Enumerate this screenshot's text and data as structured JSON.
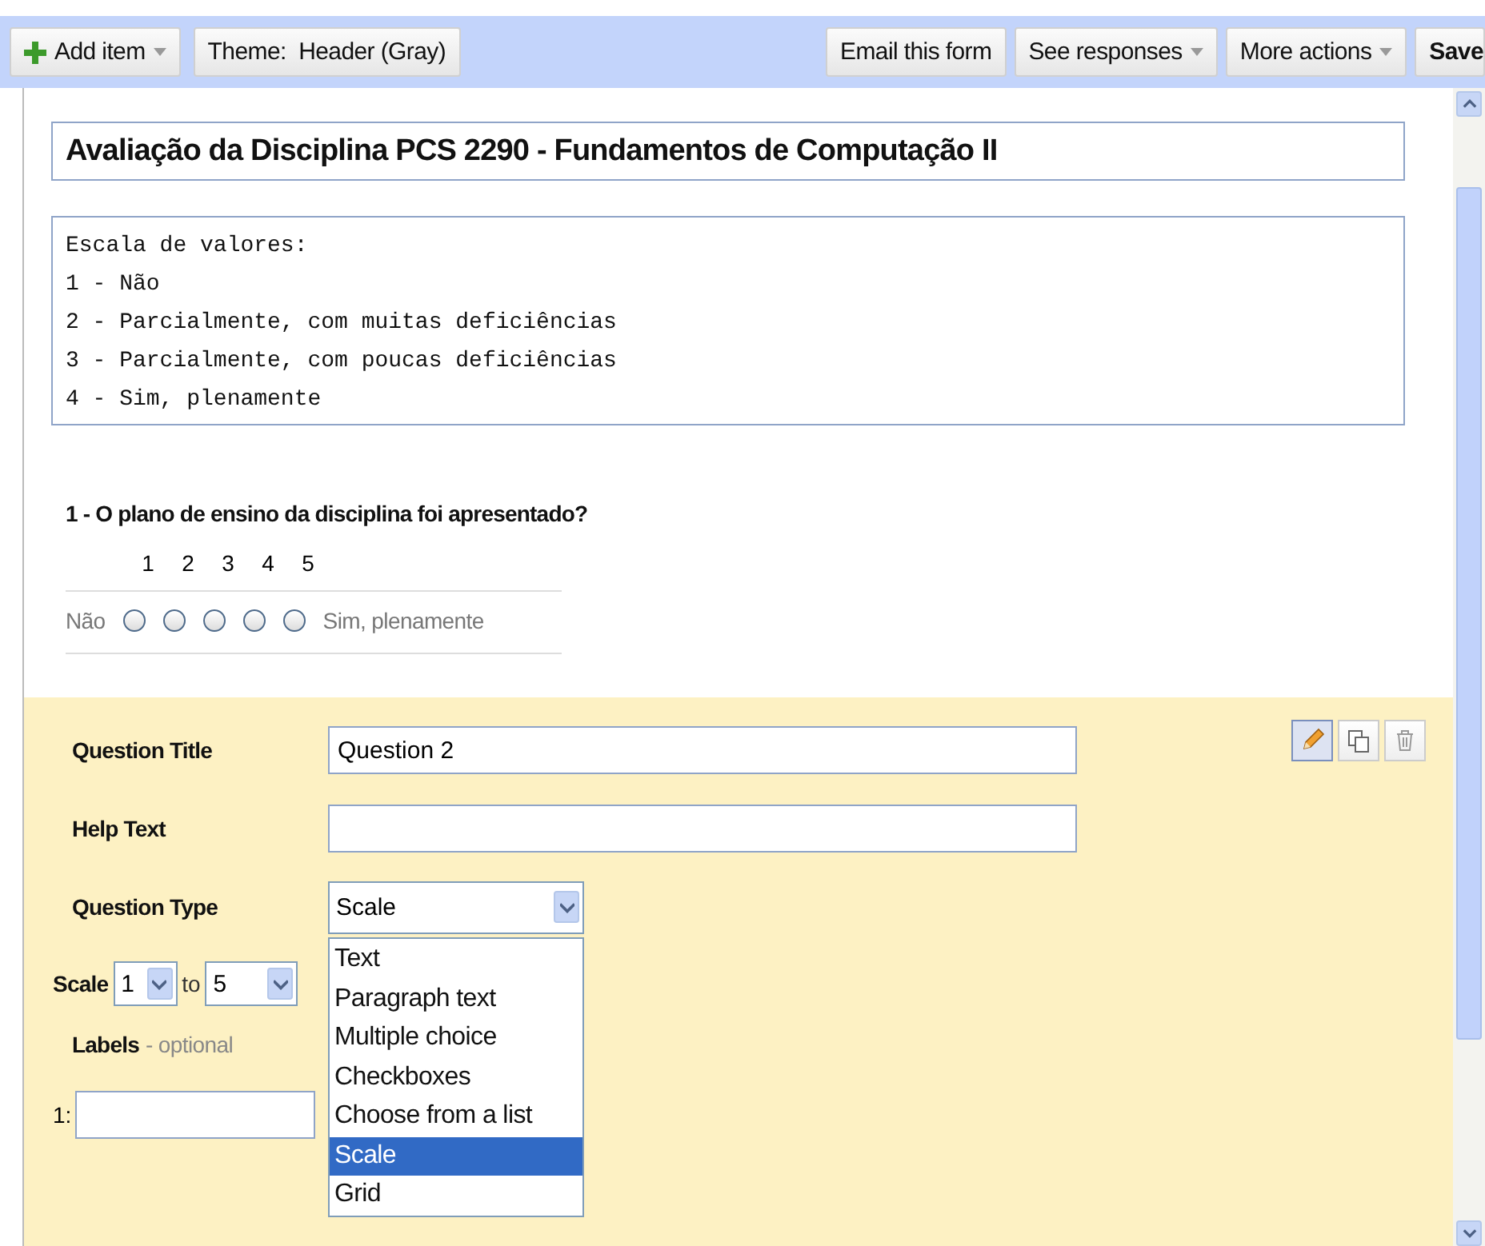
{
  "toolbar": {
    "left": [
      {
        "label": "Add item",
        "kind": "add",
        "dropdown": true
      },
      {
        "label": "Theme:  Header (Gray)",
        "kind": "plain",
        "dropdown": false
      }
    ],
    "right": [
      {
        "label": "Email this form",
        "kind": "plain",
        "dropdown": false
      },
      {
        "label": "See responses",
        "kind": "plain",
        "dropdown": true
      },
      {
        "label": "More actions",
        "kind": "plain",
        "dropdown": true
      },
      {
        "label": "Save",
        "kind": "strong",
        "dropdown": false
      }
    ]
  },
  "form": {
    "title": "Avaliação da Disciplina PCS 2290 - Fundamentos de Computação II",
    "description": [
      "Escala de valores:",
      "1 - Não",
      "2 - Parcialmente, com muitas deficiências",
      "3 - Parcialmente, com poucas deficiências",
      "4 - Sim, plenamente"
    ]
  },
  "question_1": {
    "title": "1 - O plano de ensino da disciplina foi apresentado?",
    "scale": [
      "1",
      "2",
      "3",
      "4",
      "5"
    ],
    "low_label": "Não",
    "high_label": "Sim, plenamente",
    "options": [
      {
        "checked": false
      },
      {
        "checked": false
      },
      {
        "checked": false
      },
      {
        "checked": false
      },
      {
        "checked": false
      }
    ]
  },
  "editor": {
    "tools": [
      {
        "kind": "edit",
        "selected": true
      },
      {
        "kind": "duplicate",
        "selected": false
      },
      {
        "kind": "delete",
        "selected": false
      }
    ],
    "question_title": {
      "label": "Question Title",
      "value": "Question 2"
    },
    "help_text": {
      "label": "Help Text"
    },
    "question_type": {
      "label": "Question Type",
      "value": "Scale",
      "options": [
        {
          "label": "Text",
          "selected": false
        },
        {
          "label": "Paragraph text",
          "selected": false
        },
        {
          "label": "Multiple choice",
          "selected": false
        },
        {
          "label": "Checkboxes",
          "selected": false
        },
        {
          "label": "Choose from a list",
          "selected": false
        },
        {
          "label": "Scale",
          "selected": true
        },
        {
          "label": "Grid",
          "selected": false
        }
      ]
    },
    "scale": {
      "label": "Scale",
      "from": "1",
      "to_label": "to",
      "to": "5"
    },
    "labels": {
      "label": "Labels",
      "hint": "- optional",
      "first": "1:"
    }
  }
}
